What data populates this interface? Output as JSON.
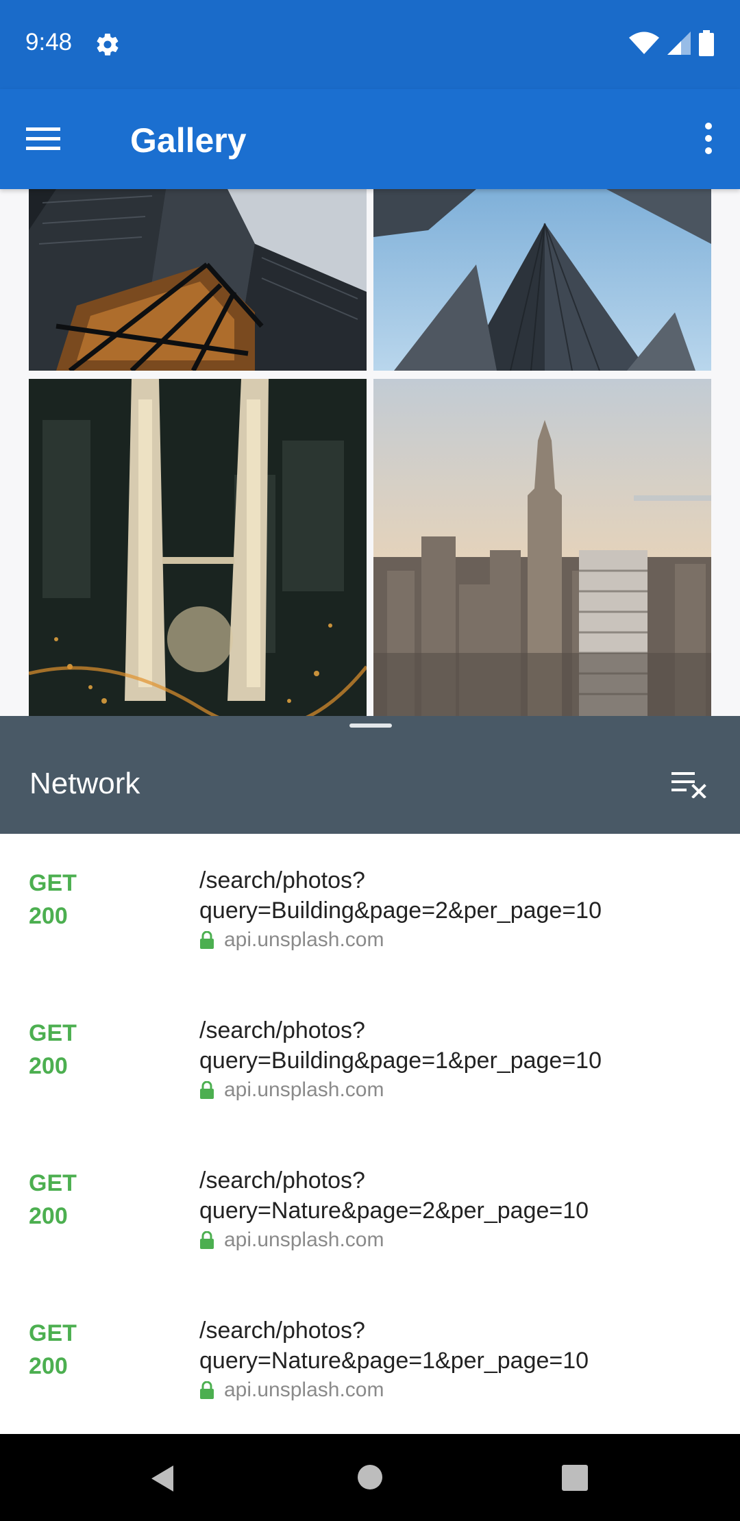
{
  "status_bar": {
    "time": "9:48"
  },
  "app_bar": {
    "title": "Gallery"
  },
  "network_panel": {
    "title": "Network"
  },
  "requests": [
    {
      "method": "GET",
      "status": "200",
      "path_line1": "/search/photos?",
      "path_line2": "query=Building&page=2&per_page=10",
      "host": "api.unsplash.com"
    },
    {
      "method": "GET",
      "status": "200",
      "path_line1": "/search/photos?",
      "path_line2": "query=Building&page=1&per_page=10",
      "host": "api.unsplash.com"
    },
    {
      "method": "GET",
      "status": "200",
      "path_line1": "/search/photos?",
      "path_line2": "query=Nature&page=2&per_page=10",
      "host": "api.unsplash.com"
    },
    {
      "method": "GET",
      "status": "200",
      "path_line1": "/search/photos?",
      "path_line2": "query=Nature&page=1&per_page=10",
      "host": "api.unsplash.com"
    }
  ],
  "colors": {
    "status_bar": "#1a6bc9",
    "app_bar": "#1b6fd0",
    "panel_header": "#495966",
    "success_green": "#4caf50"
  },
  "icons": [
    "settings-icon",
    "wifi-icon",
    "signal-icon",
    "battery-icon",
    "menu-icon",
    "more-vert-icon",
    "clear-all-icon",
    "lock-icon",
    "back-icon",
    "home-icon",
    "recents-icon"
  ]
}
